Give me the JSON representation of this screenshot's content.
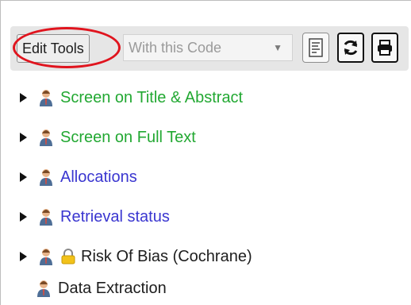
{
  "toolbar": {
    "edit_tools_label": "Edit Tools",
    "code_select_value": "With this Code",
    "code_select_arrow_icon": "triangle-down",
    "report_icon": "report-icon",
    "refresh_icon": "refresh-icon",
    "print_icon": "print-icon"
  },
  "tree": {
    "items": [
      {
        "label": "Screen on Title & Abstract",
        "color": "#22a832",
        "expandable": true,
        "locked": false
      },
      {
        "label": "Screen on Full Text",
        "color": "#22a832",
        "expandable": true,
        "locked": false
      },
      {
        "label": "Allocations",
        "color": "#3a36d0",
        "expandable": true,
        "locked": false
      },
      {
        "label": "Retrieval status",
        "color": "#3a36d0",
        "expandable": true,
        "locked": false
      },
      {
        "label": "Risk Of Bias (Cochrane)",
        "color": "#1d1d1d",
        "expandable": true,
        "locked": true
      },
      {
        "label": "Data Extraction",
        "color": "#1d1d1d",
        "expandable": false,
        "locked": false
      }
    ]
  },
  "annotation": {
    "highlight_color": "#e0141e"
  }
}
